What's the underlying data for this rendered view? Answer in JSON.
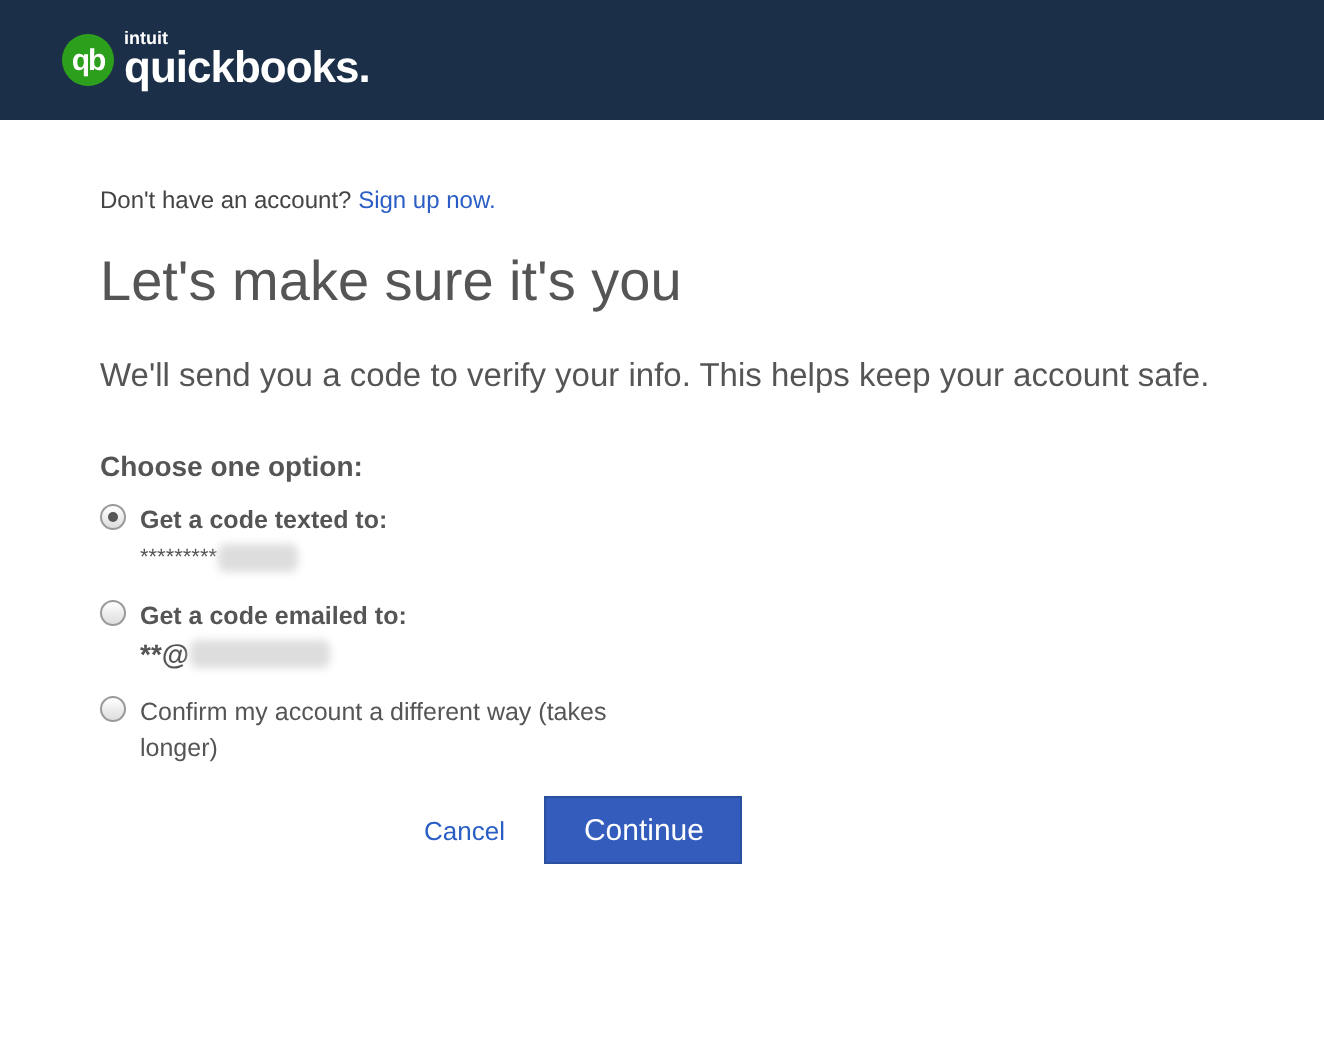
{
  "header": {
    "logo_mark": "qb",
    "brand": "intuit",
    "product": "quickbooks."
  },
  "signup": {
    "prompt": "Don't have an account?",
    "link": "Sign up now."
  },
  "title": "Let's make sure it's you",
  "subtitle": "We'll send you a code to verify your info. This helps keep your account safe.",
  "options_label": "Choose one option:",
  "options": [
    {
      "label": "Get a code texted to:",
      "detail": "*********",
      "bold": true,
      "selected": true
    },
    {
      "label": "Get a code emailed to:",
      "detail": "**@",
      "bold": true,
      "selected": false
    },
    {
      "label": "Confirm my account a different way (takes longer)",
      "bold": false,
      "selected": false
    }
  ],
  "buttons": {
    "cancel": "Cancel",
    "continue": "Continue"
  }
}
